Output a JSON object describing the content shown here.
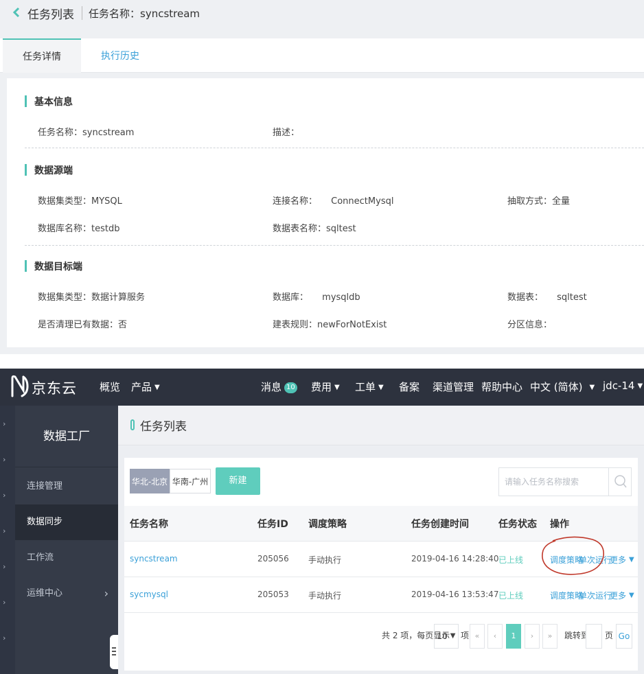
{
  "detail": {
    "header": {
      "title": "任务列表",
      "subtitle": "任务名称：syncstream"
    },
    "tabs": [
      {
        "label": "任务详情"
      },
      {
        "label": "执行历史"
      }
    ],
    "sections": {
      "basic": {
        "title": "基本信息",
        "task_name": "任务名称：syncstream",
        "description": "描述："
      },
      "source": {
        "title": "数据源端",
        "dataset_type": "数据集类型：MYSQL",
        "connection_name": "连接名称：",
        "connection_value": "ConnectMysql",
        "extract_mode": "抽取方式：全量",
        "database_name": "数据库名称：testdb",
        "table_name": "数据表名称：sqltest"
      },
      "target": {
        "title": "数据目标端",
        "dataset_type": "数据集类型：数据计算服务",
        "database_label": "数据库：",
        "database_value": "mysqldb",
        "table_label": "数据表：",
        "table_value": "sqltest",
        "clear_existing": "是否清理已有数据：否",
        "table_rule": "建表规则：newForNotExist",
        "partition": "分区信息："
      }
    }
  },
  "console": {
    "brand": "京东云",
    "nav": {
      "overview": "概览",
      "products": "产品",
      "messages": "消息",
      "message_count": "10",
      "billing": "费用",
      "tickets": "工单",
      "filing": "备案",
      "channel": "渠道管理",
      "help": "帮助中心",
      "language": "中文 (简体)",
      "user": "jdc-14"
    },
    "sidebar": {
      "title": "数据工厂",
      "items": [
        {
          "label": "连接管理"
        },
        {
          "label": "数据同步"
        },
        {
          "label": "工作流"
        },
        {
          "label": "运维中心"
        }
      ]
    },
    "page_title": "任务列表",
    "regions": [
      "华北-北京",
      "华南-广州"
    ],
    "new_button": "新建",
    "search_placeholder": "请输入任务名称搜索",
    "table": {
      "headers": [
        "任务名称",
        "任务ID",
        "调度策略",
        "任务创建时间",
        "任务状态",
        "操作"
      ],
      "rows": [
        {
          "name": "syncstream",
          "id": "205056",
          "strategy": "手动执行",
          "created": "2019-04-16 14:28:40",
          "status": "已上线"
        },
        {
          "name": "sycmysql",
          "id": "205053",
          "strategy": "手动执行",
          "created": "2019-04-16 13:53:47",
          "status": "已上线"
        }
      ],
      "actions": {
        "schedule": "调度策略",
        "run_once": "单次运行",
        "more": "更多"
      }
    },
    "pagination": {
      "summary": "共 2 项，每页显示",
      "page_size": "10",
      "unit": "项",
      "current_page": "1",
      "jump_label": "跳转到",
      "page_unit": "页",
      "go": "Go"
    },
    "colors": {
      "accent": "#5fcdbd",
      "link": "#3aa0d8",
      "navbar": "#2d323e",
      "sidebar": "#353b48"
    }
  }
}
